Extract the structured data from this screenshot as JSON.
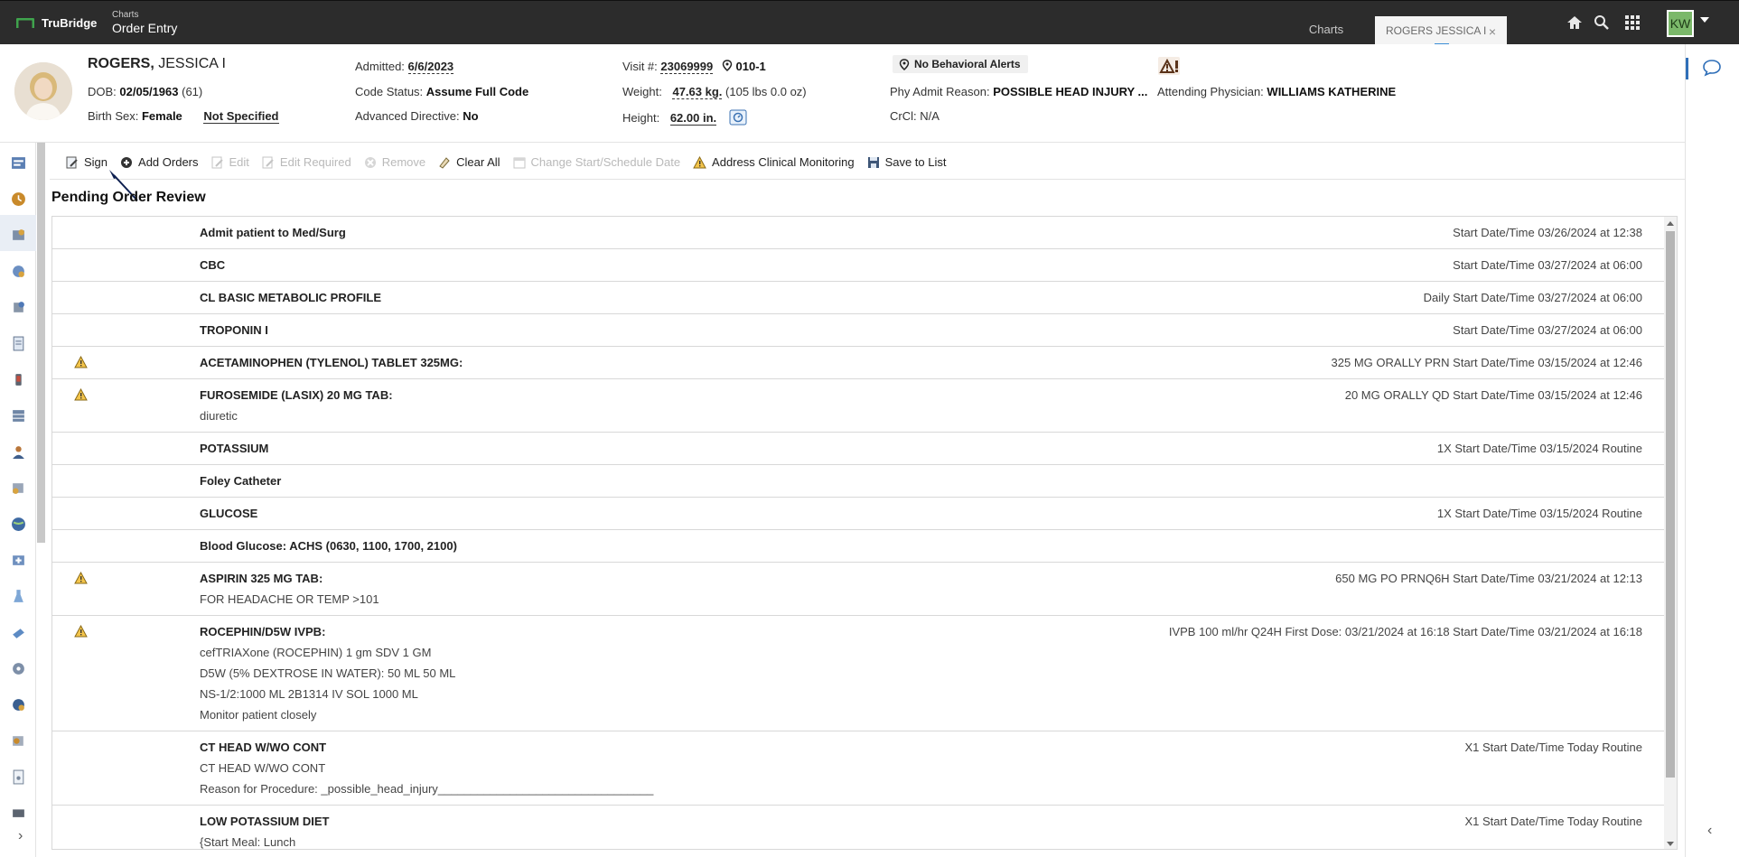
{
  "header": {
    "brand": "TruBridge",
    "app_sub": "Charts",
    "app_title": "Order Entry",
    "tabs": [
      {
        "label": "Charts",
        "active": false
      },
      {
        "label": "ROGERS JESSICA I",
        "active": true
      }
    ],
    "user_initials": "KW",
    "icons": [
      "home-icon",
      "search-icon",
      "apps-grid-icon"
    ]
  },
  "patient": {
    "last_name": "ROGERS,",
    "first_name": "JESSICA I",
    "dob_label": "DOB:",
    "dob": "02/05/1963",
    "age": "(61)",
    "birth_sex_label": "Birth Sex:",
    "birth_sex": "Female",
    "gender_identity": "Not Specified",
    "admitted_label": "Admitted:",
    "admitted": "6/6/2023",
    "code_status_label": "Code Status:",
    "code_status": "Assume Full Code",
    "adv_directive_label": "Advanced Directive:",
    "adv_directive": "No",
    "visit_label": "Visit #:",
    "visit": "23069999",
    "room": "010-1",
    "weight_label": "Weight:",
    "weight": "47.63 kg.",
    "weight_alt": "(105 lbs 0.0 oz)",
    "height_label": "Height:",
    "height": "62.00 in.",
    "behavioral_alerts": "No Behavioral Alerts",
    "phy_admit_label": "Phy Admit Reason:",
    "phy_admit": "POSSIBLE HEAD INJURY ...",
    "crcl_label": "CrCl:",
    "crcl": "N/A",
    "attending_label": "Attending Physician:",
    "attending": "WILLIAMS KATHERINE"
  },
  "toolbar": {
    "sign": "Sign",
    "add_orders": "Add Orders",
    "edit": "Edit",
    "edit_required": "Edit Required",
    "remove": "Remove",
    "clear_all": "Clear All",
    "change_start": "Change Start/Schedule Date",
    "address_monitoring": "Address Clinical Monitoring",
    "save_list": "Save to List"
  },
  "section_title": "Pending Order Review",
  "orders": [
    {
      "name": "Admit patient to Med/Surg",
      "detail": "Start Date/Time 03/26/2024 at 12:38",
      "warning": false,
      "sub": []
    },
    {
      "name": "CBC",
      "detail": "Start Date/Time 03/27/2024 at 06:00",
      "warning": false,
      "sub": []
    },
    {
      "name": "CL BASIC METABOLIC PROFILE",
      "detail": "Daily Start Date/Time 03/27/2024 at 06:00",
      "warning": false,
      "sub": []
    },
    {
      "name": "TROPONIN I",
      "detail": "Start Date/Time 03/27/2024 at 06:00",
      "warning": false,
      "sub": []
    },
    {
      "name": "ACETAMINOPHEN (TYLENOL) TABLET 325MG:",
      "detail": "325 MG ORALLY PRN Start Date/Time 03/15/2024 at 12:46",
      "warning": true,
      "sub": []
    },
    {
      "name": "FUROSEMIDE (LASIX) 20 MG TAB:",
      "detail": "20 MG ORALLY QD Start Date/Time 03/15/2024 at 12:46",
      "warning": true,
      "sub": [
        "diuretic"
      ]
    },
    {
      "name": "POTASSIUM",
      "detail": "1X Start Date/Time 03/15/2024 Routine",
      "warning": false,
      "sub": []
    },
    {
      "name": "Foley Catheter",
      "detail": "",
      "warning": false,
      "sub": []
    },
    {
      "name": "GLUCOSE",
      "detail": "1X Start Date/Time 03/15/2024 Routine",
      "warning": false,
      "sub": []
    },
    {
      "name": "Blood Glucose: ACHS (0630, 1100, 1700, 2100)",
      "detail": "",
      "warning": false,
      "sub": []
    },
    {
      "name": "ASPIRIN 325 MG TAB:",
      "detail": "650 MG PO PRNQ6H Start Date/Time 03/21/2024 at 12:13",
      "warning": true,
      "sub": [
        "FOR HEADACHE OR TEMP >101"
      ]
    },
    {
      "name": "ROCEPHIN/D5W IVPB:",
      "detail": "IVPB 100 ml/hr Q24H First Dose: 03/21/2024 at 16:18 Start Date/Time 03/21/2024 at 16:18",
      "warning": true,
      "sub": [
        "cefTRIAXone (ROCEPHIN) 1 gm SDV 1 GM",
        "D5W (5% DEXTROSE IN WATER): 50 ML 50 ML",
        "NS-1/2:1000 ML 2B1314 IV SOL 1000 ML",
        "Monitor patient closely"
      ]
    },
    {
      "name": "CT HEAD W/WO CONT",
      "detail": "X1 Start Date/Time Today Routine",
      "warning": false,
      "sub": [
        "CT HEAD W/WO CONT",
        "Reason for Procedure: _possible_head_injury_________________________________"
      ]
    },
    {
      "name": "LOW POTASSIUM DIET",
      "detail": "X1 Start Date/Time Today Routine",
      "warning": false,
      "sub": [
        "{Start Meal:   Lunch"
      ]
    }
  ]
}
